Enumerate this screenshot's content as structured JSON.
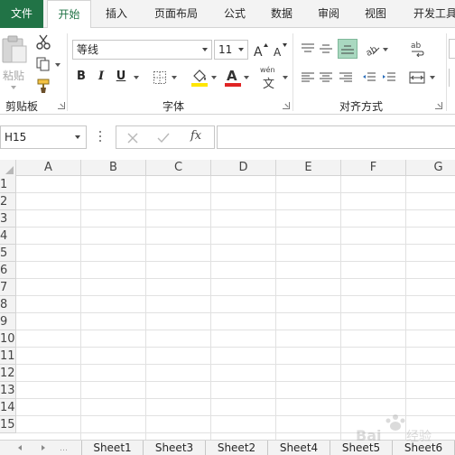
{
  "colors": {
    "accent": "#217346",
    "selected_button": "#a9d8c0",
    "font_color_bar": "#e02424",
    "fill_color_bar": "#ffe600"
  },
  "tabs": {
    "file": "文件",
    "home": "开始",
    "insert": "插入",
    "page_layout": "页面布局",
    "formulas": "公式",
    "data": "数据",
    "review": "审阅",
    "view": "视图",
    "developer": "开发工具"
  },
  "ribbon": {
    "clipboard": {
      "paste_label": "粘贴",
      "group_label": "剪贴板"
    },
    "font": {
      "font_name": "等线",
      "font_size": "11",
      "bold": "B",
      "italic": "I",
      "underline": "U",
      "font_color_letter": "A",
      "phonetic_top": "wén",
      "phonetic_char": "文",
      "group_label": "字体"
    },
    "alignment": {
      "group_label": "对齐方式"
    }
  },
  "formula_bar": {
    "name_box": "H15",
    "fx_label": "fx",
    "value": ""
  },
  "grid": {
    "columns": [
      "A",
      "B",
      "C",
      "D",
      "E",
      "F",
      "G"
    ],
    "rows": [
      "1",
      "2",
      "3",
      "4",
      "5",
      "6",
      "7",
      "8",
      "9",
      "10",
      "11",
      "12",
      "13",
      "14",
      "15"
    ]
  },
  "sheets": [
    "Sheet1",
    "Sheet3",
    "Sheet2",
    "Sheet4",
    "Sheet5",
    "Sheet6"
  ]
}
